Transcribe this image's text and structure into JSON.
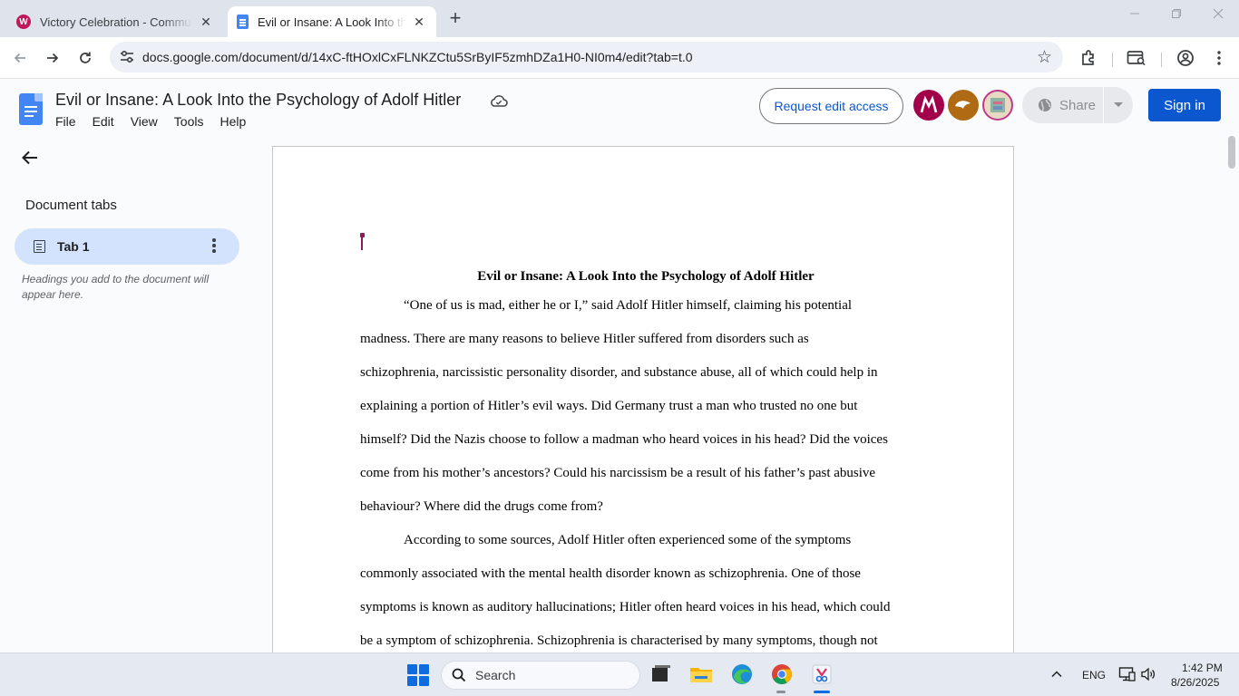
{
  "browser": {
    "tabs": [
      {
        "title": "Victory Celebration - Community",
        "favicon": "W",
        "active": false
      },
      {
        "title": "Evil or Insane: A Look Into the Psychology of Adolf Hitler",
        "active": true
      }
    ],
    "new_tab_label": "+",
    "url": "docs.google.com/document/d/14xC-ftHOxlCxFLNKZCtu5SrByIF5zmhDZa1H0-NI0m4/edit?tab=t.0"
  },
  "docs": {
    "title": "Evil or Insane: A Look Into the Psychology of Adolf Hitler",
    "menu": [
      "File",
      "Edit",
      "View",
      "Tools",
      "Help"
    ],
    "request_edit_label": "Request edit access",
    "share_label": "Share",
    "sign_in_label": "Sign in",
    "avatar_colors": [
      "#a3004c",
      "#b06a13",
      "#c0398a"
    ]
  },
  "sidebar": {
    "title": "Document tabs",
    "tab_label": "Tab 1",
    "hint": "Headings you add to the document will appear here."
  },
  "document": {
    "heading": "Evil or Insane: A Look Into the Psychology of Adolf Hitler",
    "lines": [
      {
        "text": "“One of us is mad, either he or I,” said Adolf Hitler himself, claiming his potential",
        "indent": true
      },
      {
        "text": "madness. There are many reasons to believe Hitler suffered from disorders such as",
        "indent": false
      },
      {
        "text": "schizophrenia, narcissistic personality disorder, and substance abuse, all of which could help in",
        "indent": false
      },
      {
        "text": "explaining a portion of Hitler’s evil ways. Did Germany trust a man who trusted no one but",
        "indent": false
      },
      {
        "text": "himself? Did the Nazis choose to follow a madman who heard voices in his head? Did the voices",
        "indent": false
      },
      {
        "text": "come from his mother’s ancestors? Could his narcissism be a result of his father’s past abusive",
        "indent": false
      },
      {
        "text": "behaviour? Where did the drugs come from?",
        "indent": false
      },
      {
        "text": "According to some sources, Adolf Hitler often experienced some of the symptoms",
        "indent": true
      },
      {
        "text": "commonly associated with the mental health disorder known as schizophrenia. One of those",
        "indent": false
      },
      {
        "text": "symptoms is known as auditory hallucinations; Hitler often heard voices in his head, which could",
        "indent": false
      },
      {
        "text": "be a symptom of schizophrenia. Schizophrenia is characterised by many symptoms, though not",
        "indent": false
      }
    ]
  },
  "taskbar": {
    "search_label": "Search",
    "language": "ENG",
    "time": "1:42 PM",
    "date": "8/26/2025"
  }
}
